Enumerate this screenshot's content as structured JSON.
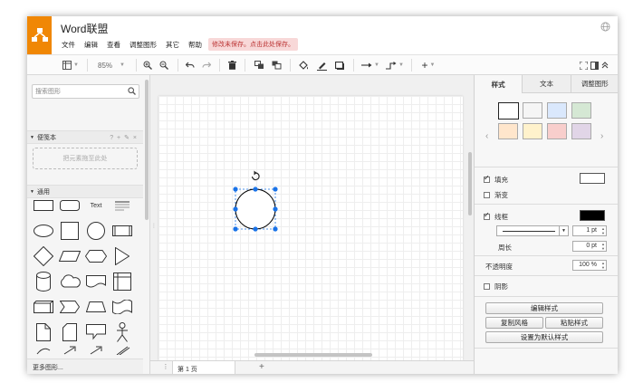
{
  "app": {
    "title": "Word联盟",
    "brand_color": "#f08705"
  },
  "menu": {
    "items": [
      "文件",
      "编辑",
      "查看",
      "调整图形",
      "其它",
      "帮助"
    ],
    "save_notice": "修改未保存。点击此处保存。"
  },
  "toolbar": {
    "zoom": "85%",
    "icons": [
      "page-view-icon",
      "zoom-in-icon",
      "zoom-out-icon",
      "undo-icon",
      "redo-icon",
      "delete-icon",
      "to-front-icon",
      "to-back-icon",
      "fill-color-icon",
      "line-color-icon",
      "shadow-icon",
      "connection-icon",
      "waypoints-icon",
      "insert-icon",
      "fullscreen-icon",
      "format-panel-icon",
      "collapse-icon"
    ]
  },
  "sidebar": {
    "search_placeholder": "搜索图形",
    "scratchpad_title": "便笺本",
    "scratchpad_tools": "? + ✎ ×",
    "drop_hint": "把元素拖至此处",
    "general_title": "通用",
    "text_shape_label": "Text",
    "more_shapes": "更多图形..."
  },
  "pages": {
    "tab_label": "第 1 页"
  },
  "format_panel": {
    "tabs": [
      "样式",
      "文本",
      "调整图形"
    ],
    "swatch_colors": [
      "#ffffff",
      "#f5f5f5",
      "#dae8fc",
      "#d5e8d4",
      "#ffe6cc",
      "#fff2cc",
      "#f8cecc",
      "#e1d5e7"
    ],
    "fill_label": "填充",
    "gradient_label": "渐变",
    "line_label": "线框",
    "line_width": "1 pt",
    "perimeter_label": "周长",
    "perimeter_value": "0 pt",
    "opacity_label": "不透明度",
    "opacity_value": "100 %",
    "shadow_label": "阴影",
    "edit_style": "编辑样式",
    "copy_style": "复制风格",
    "paste_style": "粘贴样式",
    "set_default": "设置为默认样式",
    "fill_color": "#ffffff",
    "line_color": "#000000"
  },
  "selection_color": "#1a73e8"
}
